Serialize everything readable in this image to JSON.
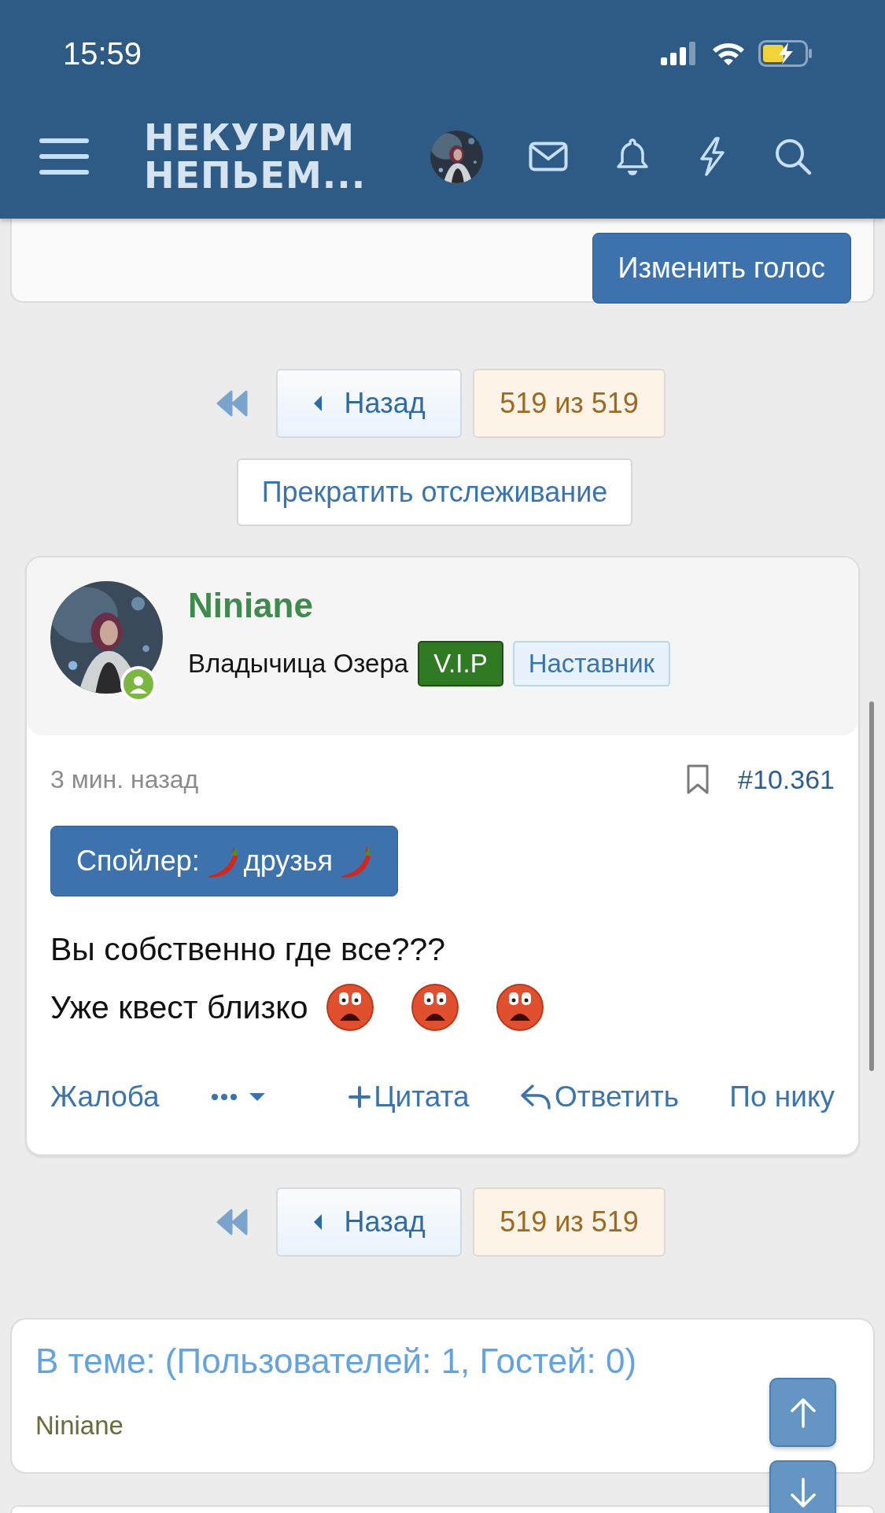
{
  "status_bar": {
    "time": "15:59"
  },
  "header": {
    "logo_lines": [
      "НЕКУРИМ",
      "НЕПЬЕМ..."
    ]
  },
  "poll": {
    "button": "Изменить голос"
  },
  "pagination_top": {
    "back": "Назад",
    "page": "519 из 519"
  },
  "unwatch_button": "Прекратить отслеживание",
  "post": {
    "author": "Niniane",
    "online": true,
    "user_title": "Владычица Озера",
    "badges": [
      {
        "label": "V.I.P",
        "kind": "vip"
      },
      {
        "label": "Наставник",
        "kind": "mentor"
      }
    ],
    "time": "3 мин. назад",
    "number": "#10.361",
    "spoiler": {
      "label": "Спойлер:",
      "title": "друзья"
    },
    "lines": [
      {
        "text": "Вы собственно где все???"
      },
      {
        "text": "Уже квест близко",
        "smileys": [
          {
            "kind": "scream"
          },
          {
            "kind": "scream"
          },
          {
            "kind": "scream"
          }
        ]
      }
    ],
    "actions": [
      {
        "kind": "report",
        "label": "Жалоба"
      },
      {
        "kind": "more"
      },
      {
        "kind": "quote",
        "label": "Цитата"
      },
      {
        "kind": "reply",
        "label": "Ответить"
      },
      {
        "kind": "mention",
        "label": "По нику"
      }
    ]
  },
  "pagination_bottom": {
    "back": "Назад",
    "page": "519 из 519"
  },
  "online": {
    "title": "В теме: (Пользователей: 1, Гостей: 0)",
    "users": [
      {
        "name": "Niniane"
      }
    ]
  }
}
